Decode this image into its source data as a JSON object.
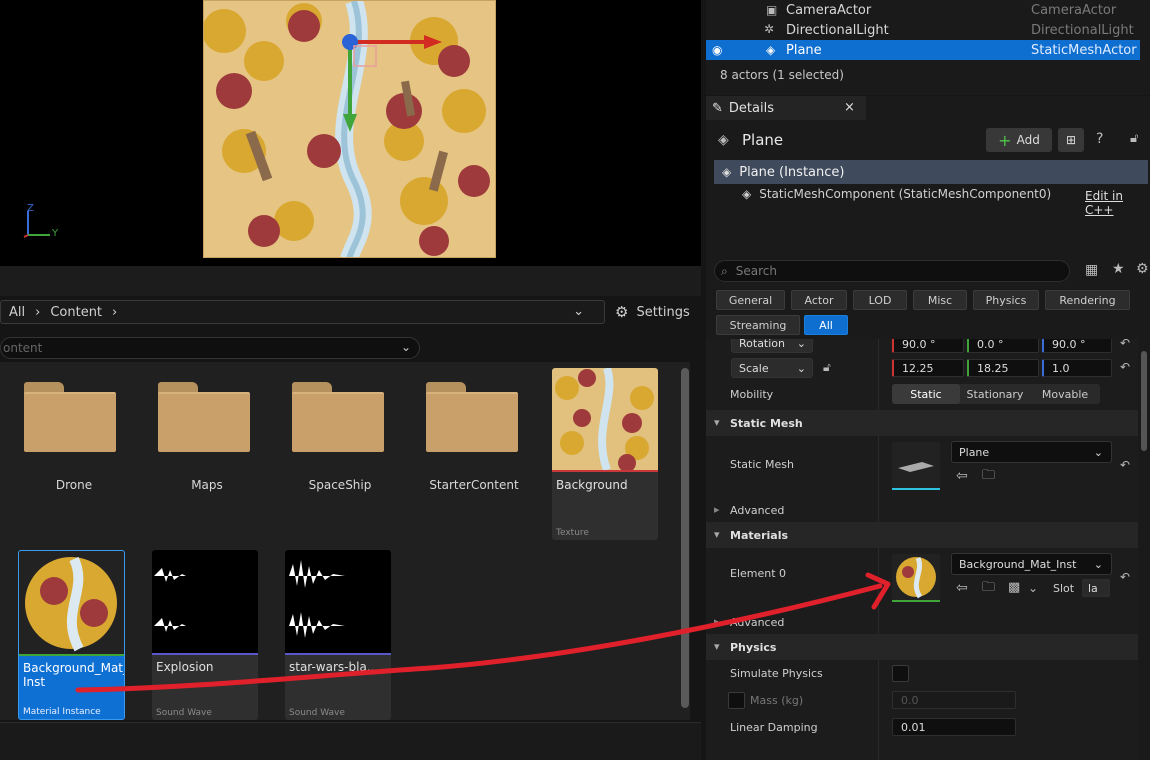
{
  "viewport": {
    "axis_z": "Z",
    "axis_y": "Y",
    "axis_x": "X"
  },
  "content_browser": {
    "breadcrumb": [
      "All",
      "Content"
    ],
    "settings_label": "Settings",
    "path_value": "ontent",
    "folders": [
      "Drone",
      "Maps",
      "SpaceShip",
      "StarterContent"
    ],
    "assets": [
      {
        "name": "Background",
        "class": "Texture"
      },
      {
        "name": "Background_Mat_\nInst",
        "class": "Material Instance"
      },
      {
        "name": "Explosion",
        "class": "Sound Wave"
      },
      {
        "name": "star-wars-bla...",
        "class": "Sound Wave"
      }
    ]
  },
  "outliner": {
    "rows": [
      {
        "name": "CameraActor",
        "type": "CameraActor"
      },
      {
        "name": "DirectionalLight",
        "type": "DirectionalLight"
      },
      {
        "name": "Plane",
        "type": "StaticMeshActor"
      }
    ],
    "status": "8 actors (1 selected)"
  },
  "details": {
    "tab_label": "Details",
    "actor_name": "Plane",
    "add_label": "Add",
    "instance_label": "Plane (Instance)",
    "component_label": "StaticMeshComponent (StaticMeshComponent0)",
    "edit_cpp": "Edit in C++",
    "search_placeholder": "Search",
    "filters": [
      "General",
      "Actor",
      "LOD",
      "Misc",
      "Physics",
      "Rendering",
      "Streaming",
      "All"
    ],
    "rotation_label": "Rotation",
    "rotation": [
      "90.0 °",
      "0.0 °",
      "90.0 °"
    ],
    "scale_label": "Scale",
    "scale": [
      "12.25",
      "18.25",
      "1.0"
    ],
    "mobility_label": "Mobility",
    "mobility_options": [
      "Static",
      "Stationary",
      "Movable"
    ],
    "static_mesh_section": "Static Mesh",
    "static_mesh_label": "Static Mesh",
    "static_mesh_value": "Plane",
    "advanced_label": "Advanced",
    "materials_section": "Materials",
    "element0_label": "Element 0",
    "material_value": "Background_Mat_Inst",
    "slot_label": "Slot",
    "slot_value": "la",
    "advanced_label2": "Advanced",
    "physics_section": "Physics",
    "simulate_label": "Simulate Physics",
    "mass_label": "Mass (kg)",
    "mass_value": "0.0",
    "damping_label": "Linear Damping",
    "damping_value": "0.01"
  },
  "colors": {
    "accent": "#0f6fd0",
    "annotation": "#e0202a"
  }
}
